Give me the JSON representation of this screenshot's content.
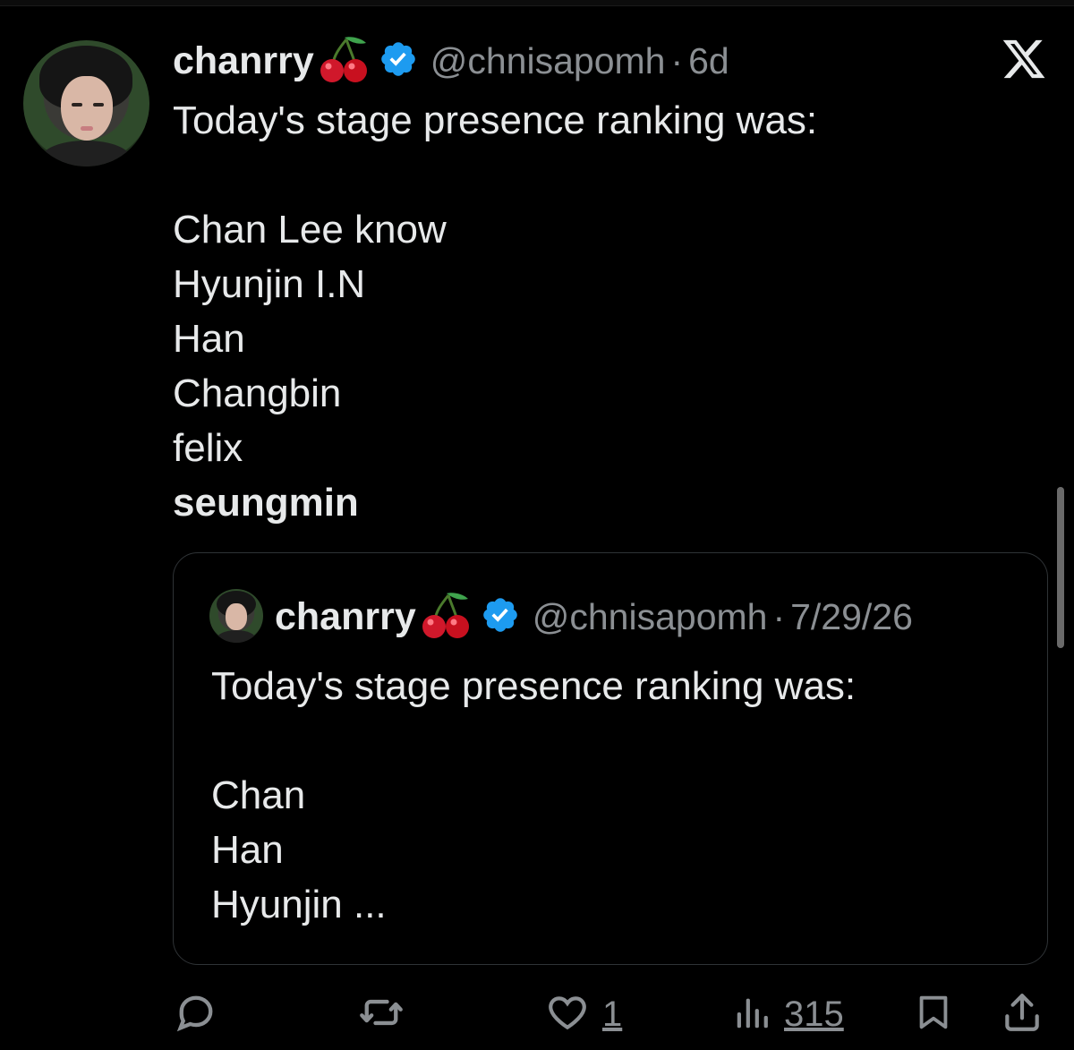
{
  "tweet": {
    "display_name": "chanrry",
    "name_emoji": "cherry",
    "verified": true,
    "handle": "@chnisapomh",
    "separator": "·",
    "time": "6d",
    "lines": [
      "Today's stage presence ranking was:",
      "",
      "Chan Lee know",
      "Hyunjin I.N",
      "Han",
      "Changbin",
      "felix",
      "seungmin"
    ]
  },
  "quoted": {
    "display_name": "chanrry",
    "name_emoji": "cherry",
    "verified": true,
    "handle": "@chnisapomh",
    "separator": "·",
    "time": "7/29/26",
    "lines": [
      "Today's stage presence ranking was:",
      "",
      "Chan",
      "Han",
      "Hyunjin ..."
    ]
  },
  "actions": {
    "reply_icon": "reply-icon",
    "retweet_icon": "retweet-icon",
    "like_icon": "heart-icon",
    "like_count": "1",
    "views_icon": "views-icon",
    "views_count": "315",
    "bookmark_icon": "bookmark-icon",
    "share_icon": "share-icon"
  },
  "colors": {
    "background": "#000000",
    "text": "#e7e9ea",
    "secondary": "#8b8f93",
    "verified": "#1d9bf0",
    "border": "#2f3336"
  }
}
